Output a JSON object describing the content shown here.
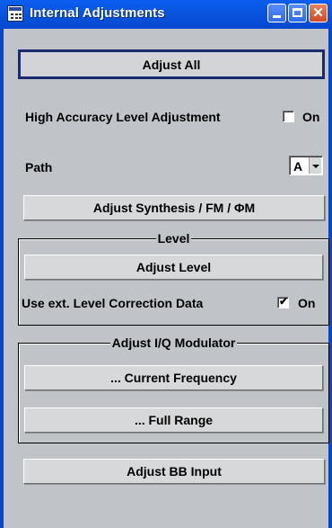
{
  "window": {
    "title": "Internal Adjustments",
    "close_glyph": "✕",
    "icons": {
      "app": "calendar-icon",
      "minimize": "minimize-icon",
      "maximize": "maximize-icon",
      "close": "close-icon"
    }
  },
  "buttons": {
    "adjust_all": "Adjust All",
    "adjust_synthesis": "Adjust Synthesis / FM / ΦM",
    "adjust_level": "Adjust Level",
    "current_frequency": "... Current Frequency",
    "full_range": "... Full Range",
    "adjust_bb_input": "Adjust BB Input"
  },
  "high_accuracy": {
    "label": "High Accuracy Level Adjustment",
    "checkbox_label": "On",
    "checked": false
  },
  "path": {
    "label": "Path",
    "value": "A"
  },
  "level_group": {
    "title": "Level",
    "ext_correction": {
      "label": "Use ext. Level Correction Data",
      "checkbox_label": "On",
      "checked": true,
      "tick": "✔"
    }
  },
  "iq_group": {
    "title": "Adjust I/Q Modulator"
  },
  "colors": {
    "title_bar": "#0a56e0",
    "panel": "#c0c4c9",
    "button": "#d7d8da",
    "primary_border": "#1a2a6e",
    "close_button": "#cf4a24"
  }
}
